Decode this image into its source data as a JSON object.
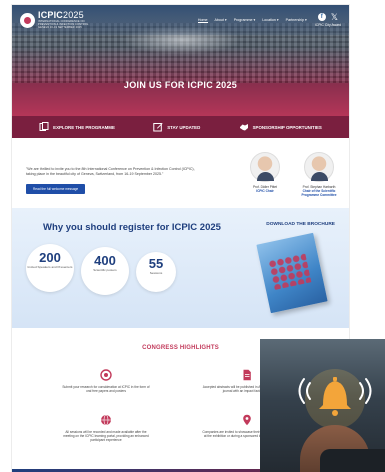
{
  "header": {
    "logo_title": "ICPIC",
    "logo_year": "2025",
    "logo_sub_1": "INTERNATIONAL CONFERENCE ON",
    "logo_sub_2": "PREVENTION & INFECTION CONTROL",
    "logo_sub_3": "GENEVA 16-19 SEPTEMBER 2025",
    "nav": [
      "Home",
      "About ▾",
      "Programme ▾",
      "Location ▾",
      "Partnership ▾"
    ],
    "award_link": "ICPIC City Award"
  },
  "hero": {
    "title": "JOIN US FOR ICPIC 2025"
  },
  "actions": [
    {
      "label": "EXPLORE THE PROGRAMME",
      "icon": "programme-icon"
    },
    {
      "label": "STAY UPDATED",
      "icon": "edit-icon"
    },
    {
      "label": "SPONSORSHIP OPPORTUNITIES",
      "icon": "handshake-icon"
    }
  ],
  "intro": {
    "text": "\"We are thrilled to invite you to the 8th International Conference on Prevention & Infection Control (ICPIC), taking place in the beautiful city of Geneva, Switzerland, from 16-19 September 2025.\"",
    "button": "Read the full welcome message",
    "people": [
      {
        "name": "Prof. Didier Pittet",
        "role": "ICPIC Chair"
      },
      {
        "name": "Prof. Stephan Harbarth",
        "role": "Chair of the Scientific Programme Committee"
      }
    ]
  },
  "register": {
    "title": "Why you should register for ICPIC 2025",
    "brochure": "DOWNLOAD THE BROCHURE",
    "stats": [
      {
        "value": "200",
        "label": "Invited Speakers and Presenters"
      },
      {
        "value": "400",
        "label": "Scientific posters"
      },
      {
        "value": "55",
        "label": "Sessions"
      }
    ]
  },
  "highlights": {
    "title": "CONGRESS HIGHLIGHTS",
    "items": [
      {
        "text": "Submit your research for consideration at ICPIC in the form of oral free papers and posters",
        "icon": "target-icon"
      },
      {
        "text": "Accepted abstracts will be published in ARIC, the official ICPIC journal with an impact factor of 4.5",
        "icon": "document-icon"
      },
      {
        "text": "All sessions will be recorded and made available after the meeting on the ICPIC learning portal, providing an enhanced participant experience",
        "icon": "globe-icon"
      },
      {
        "text": "Companies are invited to showcase their services and products at the exhibition or during a sponsored integrated symposium",
        "icon": "location-pin-icon"
      }
    ]
  },
  "colors": {
    "primary": "#1f3f7e",
    "accent": "#c23a5b",
    "maroon": "#7a1f3f",
    "button": "#1f4ea8"
  }
}
